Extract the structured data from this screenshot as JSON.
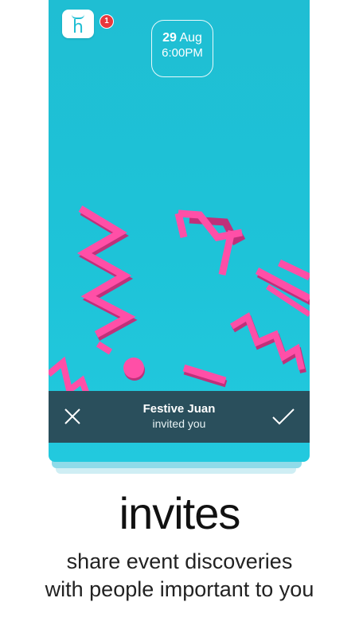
{
  "app": {
    "icon_letter": "h",
    "notification_count": "1"
  },
  "event": {
    "day": "29",
    "month": "Aug",
    "time": "6:00PM"
  },
  "invite": {
    "inviter": "Festive Juan",
    "message": "invited you"
  },
  "promo": {
    "headline": "invites",
    "line1": "share event discoveries",
    "line2": "with people important to you"
  },
  "colors": {
    "card_bg": "#1fbed3",
    "shape_pink": "#ff4fa7",
    "invite_bar": "#2a4f5c",
    "notification": "#e8383d"
  },
  "icons": [
    "h-app-icon",
    "close-icon",
    "checkmark-icon"
  ]
}
